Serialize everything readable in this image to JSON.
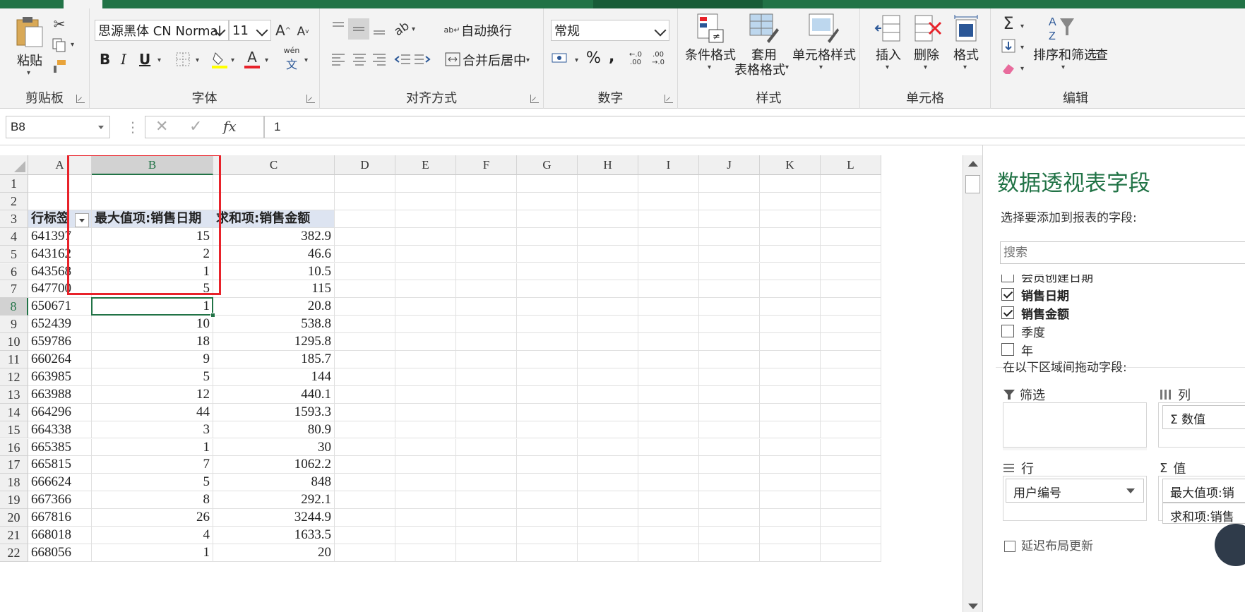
{
  "ribbon": {
    "clipboard": {
      "label": "剪贴板",
      "paste": "粘贴"
    },
    "font": {
      "label": "字体",
      "font_name": "思源黑体 CN Normal",
      "font_size": "11",
      "bold": "B",
      "italic": "I",
      "underline": "U",
      "phonetic": "wén"
    },
    "alignment": {
      "label": "对齐方式",
      "wrap": "自动换行",
      "merge": "合并后居中"
    },
    "number": {
      "label": "数字",
      "format": "常规",
      "percent": "%",
      "comma": ","
    },
    "styles": {
      "label": "样式",
      "conditional": "条件格式",
      "table_1": "套用",
      "table_2": "表格格式",
      "cell_styles": "单元格样式"
    },
    "cells": {
      "label": "单元格",
      "insert": "插入",
      "delete": "删除",
      "format": "格式"
    },
    "editing": {
      "label": "编辑",
      "sort": "排序和筛选",
      "find": "查"
    }
  },
  "formula_bar": {
    "name_box": "B8",
    "fx": "fx",
    "value": "1"
  },
  "columns": [
    "A",
    "B",
    "C",
    "D",
    "E",
    "F",
    "G",
    "H",
    "I",
    "J",
    "K",
    "L"
  ],
  "row_numbers": [
    "1",
    "2",
    "3",
    "4",
    "5",
    "6",
    "7",
    "8",
    "9",
    "10",
    "11",
    "12",
    "13",
    "14",
    "15",
    "16",
    "17",
    "18",
    "19",
    "20",
    "21",
    "22"
  ],
  "pivot": {
    "headers": [
      "行标签",
      "最大值项:销售日期",
      "求和项:销售金额"
    ],
    "rows": [
      {
        "label": "641397",
        "max": "15",
        "sum": "382.9"
      },
      {
        "label": "643162",
        "max": "2",
        "sum": "46.6"
      },
      {
        "label": "643568",
        "max": "1",
        "sum": "10.5"
      },
      {
        "label": "647700",
        "max": "5",
        "sum": "115"
      },
      {
        "label": "650671",
        "max": "1",
        "sum": "20.8"
      },
      {
        "label": "652439",
        "max": "10",
        "sum": "538.8"
      },
      {
        "label": "659786",
        "max": "18",
        "sum": "1295.8"
      },
      {
        "label": "660264",
        "max": "9",
        "sum": "185.7"
      },
      {
        "label": "663985",
        "max": "5",
        "sum": "144"
      },
      {
        "label": "663988",
        "max": "12",
        "sum": "440.1"
      },
      {
        "label": "664296",
        "max": "44",
        "sum": "1593.3"
      },
      {
        "label": "664338",
        "max": "3",
        "sum": "80.9"
      },
      {
        "label": "665385",
        "max": "1",
        "sum": "30"
      },
      {
        "label": "665815",
        "max": "7",
        "sum": "1062.2"
      },
      {
        "label": "666624",
        "max": "5",
        "sum": "848"
      },
      {
        "label": "667366",
        "max": "8",
        "sum": "292.1"
      },
      {
        "label": "667816",
        "max": "26",
        "sum": "3244.9"
      },
      {
        "label": "668018",
        "max": "4",
        "sum": "1633.5"
      },
      {
        "label": "668056",
        "max": "1",
        "sum": "20"
      }
    ]
  },
  "pane": {
    "title": "数据透视表字段",
    "subtitle": "选择要添加到报表的字段:",
    "search_placeholder": "搜索",
    "fields": [
      {
        "name": "会员创建日期",
        "checked": false
      },
      {
        "name": "销售日期",
        "checked": true
      },
      {
        "name": "销售金额",
        "checked": true
      },
      {
        "name": "季度",
        "checked": false
      },
      {
        "name": "年",
        "checked": false
      }
    ],
    "drag_label": "在以下区域间拖动字段:",
    "areas": {
      "filter": "筛选",
      "columns": "列",
      "columns_chip": "Σ 数值",
      "rows": "行",
      "rows_chip": "用户编号",
      "values": "值",
      "values_chip_1": "最大值项:销",
      "values_chip_2": "求和项:销售"
    },
    "defer_update": "延迟布局更新"
  }
}
